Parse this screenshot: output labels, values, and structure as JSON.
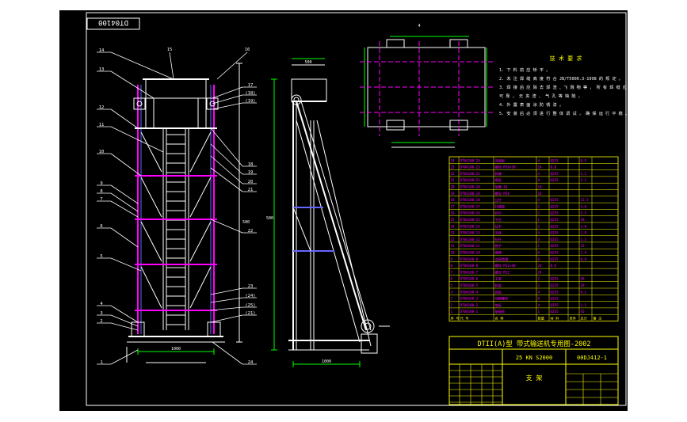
{
  "drawing": {
    "stamp": "DT04100",
    "top_text": "4",
    "top_dim": "500",
    "side_dim": "500",
    "front_base_dim": "1000",
    "side_base_dim": "1000",
    "colors": {
      "background": "#000000",
      "outline": "#ffffff",
      "annotation": "#ffff00",
      "accent": "#ff00ff",
      "structure_blue": "#6666ff",
      "dims": "#00ff00"
    }
  },
  "notes": {
    "title": "技 术 要 求",
    "lines": [
      "1. 下 料 前 应 矫 平 。",
      "2. 未 注 焊 缝 高 度 符 合 JB/T5000.3-1998 的 规 定 。",
      "3. 焊 接 后 应 除 去 焊 渣 、飞 溅 物 等 ， 所 有 焊 缝 应 牢 固",
      "   可 靠 ， 无 夹 渣 、 气 孔 等 缺 陷 。",
      "4. 外 露 表 面 涂 防 锈 漆 。",
      "5. 安 装 后 必 须 进 行 整 体 调 试 ， 确 保 运 行 平 稳 。"
    ]
  },
  "callouts": {
    "front_left": [
      "14",
      "13",
      "12",
      "11",
      "10",
      "9",
      "8",
      "7",
      "6",
      "5",
      "4",
      "3",
      "2",
      "1"
    ],
    "front_top": [
      "15",
      "16"
    ],
    "front_right": [
      "17",
      "(18)",
      "(19)",
      "18",
      "19",
      "20",
      "21",
      "22",
      "23",
      "(24)",
      "(25)",
      "(21)",
      "24"
    ]
  },
  "bom": {
    "rows": [
      [
        "24",
        "DT04100-24",
        "连接板",
        "4",
        "Q235",
        "",
        "0.5",
        ""
      ],
      [
        "23",
        "DT04100-23",
        "螺栓 M16×50",
        "16",
        "8.8",
        "",
        "",
        ""
      ],
      [
        "22",
        "DT04100-22",
        "斜撑",
        "4",
        "Q235",
        "",
        "3.2",
        ""
      ],
      [
        "21",
        "DT04100-21",
        "横梁",
        "8",
        "Q235",
        "",
        "2.1",
        ""
      ],
      [
        "20",
        "DT04100-20",
        "垫圈 16",
        "16",
        "",
        "",
        "",
        ""
      ],
      [
        "19",
        "DT04100-19",
        "螺母 M16",
        "16",
        "",
        "",
        "",
        ""
      ],
      [
        "18",
        "DT04100-18",
        "立柱",
        "4",
        "Q235",
        "",
        "12.5",
        ""
      ],
      [
        "17",
        "DT04100-17",
        "托辊架",
        "2",
        "Q235",
        "",
        "4.6",
        ""
      ],
      [
        "16",
        "DT04100-16",
        "护栏",
        "2",
        "Q235",
        "",
        "5.3",
        ""
      ],
      [
        "15",
        "DT04100-15",
        "平台",
        "1",
        "Q235",
        "",
        "18",
        ""
      ],
      [
        "14",
        "DT04100-14",
        "扶手",
        "2",
        "Q235",
        "",
        "3.0",
        ""
      ],
      [
        "13",
        "DT04100-13",
        "支座",
        "4",
        "Q235",
        "",
        "1.8",
        ""
      ],
      [
        "12",
        "DT04100-12",
        "拉杆",
        "4",
        "Q235",
        "",
        "1.2",
        ""
      ],
      [
        "11",
        "DT04100-11",
        "梯子",
        "1",
        "Q235",
        "",
        "22",
        ""
      ],
      [
        "10",
        "DT04100-10",
        "横撑",
        "6",
        "Q235",
        "",
        "2.4",
        ""
      ],
      [
        "9",
        "DT04100-9",
        "连接角钢",
        "8",
        "Q235",
        "",
        "0.9",
        ""
      ],
      [
        "8",
        "DT04100-8",
        "螺栓 M12×40",
        "24",
        "8.8",
        "",
        "",
        ""
      ],
      [
        "7",
        "DT04100-7",
        "螺母 M12",
        "24",
        "",
        "",
        "",
        ""
      ],
      [
        "6",
        "DT04100-6",
        "主梁",
        "2",
        "Q235",
        "",
        "36",
        ""
      ],
      [
        "5",
        "DT04100-5",
        "斜梁",
        "2",
        "Q235",
        "",
        "28",
        ""
      ],
      [
        "4",
        "DT04100-4",
        "底板",
        "4",
        "Q235",
        "",
        "6.2",
        ""
      ],
      [
        "3",
        "DT04100-3",
        "地脚螺栓",
        "8",
        "Q235",
        "",
        "",
        ""
      ],
      [
        "2",
        "DT04100-2",
        "垫板",
        "4",
        "Q235",
        "",
        "1.1",
        ""
      ],
      [
        "1",
        "DT04100-1",
        "基础框",
        "1",
        "Q235",
        "",
        "45",
        ""
      ]
    ],
    "header": [
      "序 号",
      "代 号",
      "名 称",
      "数量",
      "材 料",
      "单件",
      "总计",
      "备 注"
    ]
  },
  "title_block": {
    "main_title": "DTII(A)型 带式输送机专用图-2002",
    "spec": "25 KN S2000",
    "drawing_no": "00DJ412-1",
    "part_name": "支 架"
  }
}
